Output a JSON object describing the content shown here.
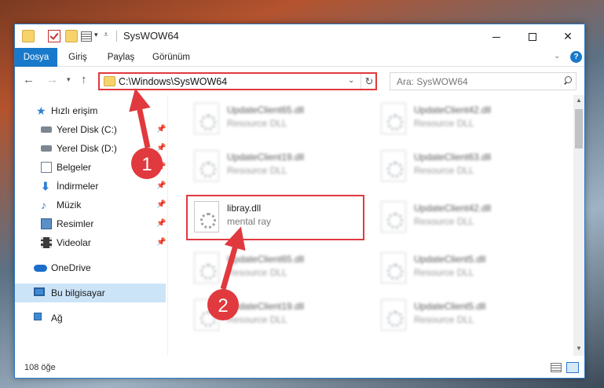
{
  "window": {
    "title": "SysWOW64"
  },
  "ribbon": {
    "tabs": [
      "Dosya",
      "Giriş",
      "Paylaş",
      "Görünüm"
    ],
    "help": "?"
  },
  "nav": {
    "address": "C:\\Windows\\SysWOW64",
    "search_placeholder": "Ara: SysWOW64"
  },
  "sidebar": {
    "items": [
      {
        "label": "Hızlı erişim",
        "icon": "star-icon"
      },
      {
        "label": "Yerel Disk (C:)",
        "icon": "drive-icon",
        "pinned": true
      },
      {
        "label": "Yerel Disk (D:)",
        "icon": "drive-icon",
        "pinned": true
      },
      {
        "label": "Belgeler",
        "icon": "documents-icon",
        "pinned": true
      },
      {
        "label": "İndirmeler",
        "icon": "download-icon",
        "pinned": true
      },
      {
        "label": "Müzik",
        "icon": "music-icon",
        "pinned": true
      },
      {
        "label": "Resimler",
        "icon": "pictures-icon",
        "pinned": true
      },
      {
        "label": "Videolar",
        "icon": "video-icon",
        "pinned": true
      },
      {
        "label": "OneDrive",
        "icon": "onedrive-icon"
      },
      {
        "label": "Bu bilgisayar",
        "icon": "computer-icon",
        "selected": true
      },
      {
        "label": "Ağ",
        "icon": "network-icon"
      }
    ]
  },
  "files": [
    {
      "name": "UpdateClient65.dll",
      "type": "Resource DLL"
    },
    {
      "name": "UpdateClient42.dll",
      "type": "Resource DLL"
    },
    {
      "name": "UpdateClient19.dll",
      "type": "Resource DLL"
    },
    {
      "name": "UpdateClient63.dll",
      "type": "Resource DLL"
    },
    {
      "name": "libray.dll",
      "type": "mental ray"
    },
    {
      "name": "UpdateClient42.dll",
      "type": "Resource DLL"
    },
    {
      "name": "UpdateClient65.dll",
      "type": "Resource DLL"
    },
    {
      "name": "UpdateClient5.dll",
      "type": "Resource DLL"
    },
    {
      "name": "UpdateClient19.dll",
      "type": "Resource DLL"
    },
    {
      "name": "UpdateClient5.dll",
      "type": "Resource DLL"
    }
  ],
  "status": {
    "item_count": "108 öğe"
  },
  "annotations": {
    "badge1": "1",
    "badge2": "2",
    "color": "#e0393e"
  }
}
